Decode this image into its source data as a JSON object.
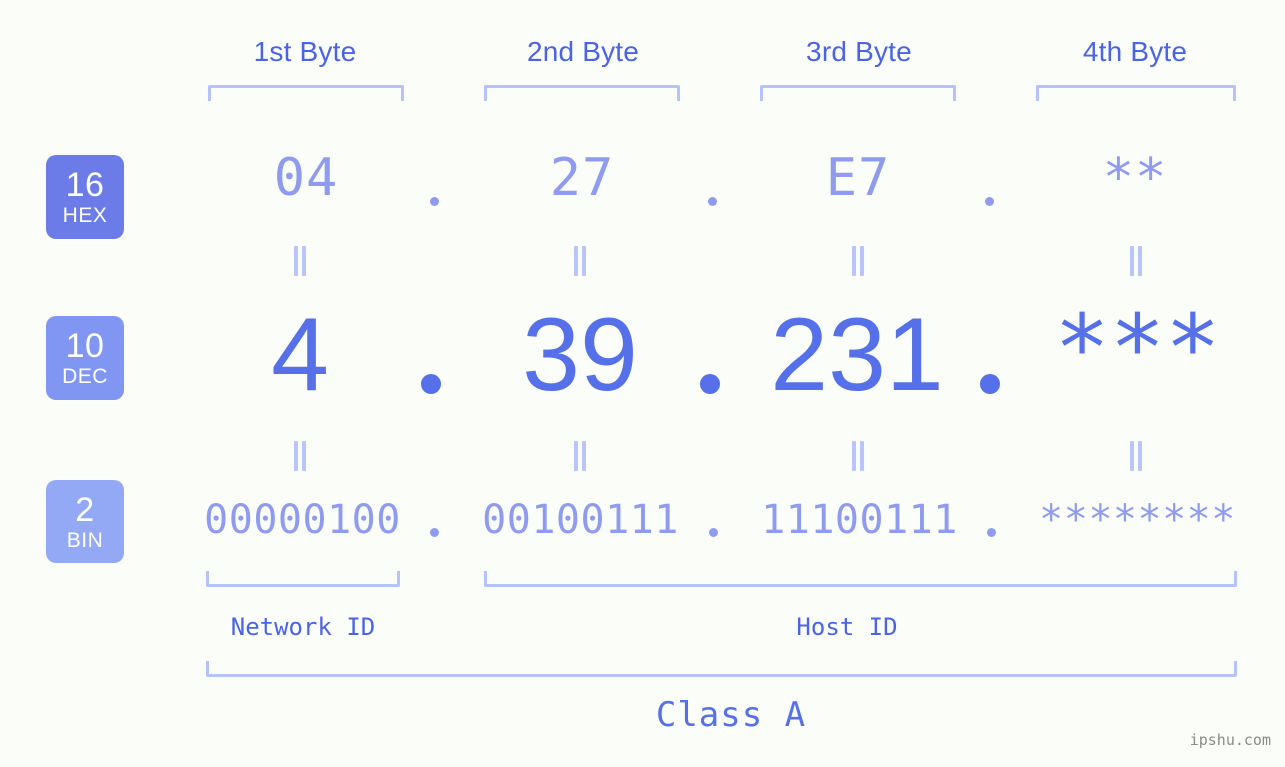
{
  "watermark": "ipshu.com",
  "byte_headers": [
    {
      "label": "1st Byte"
    },
    {
      "label": "2nd Byte"
    },
    {
      "label": "3rd Byte"
    },
    {
      "label": "4th Byte"
    }
  ],
  "rows": [
    {
      "base": "16",
      "base_name": "HEX",
      "badge_color": "#6b7ce9",
      "text_color": "#8e9bf0",
      "values": [
        "04",
        "27",
        "E7",
        "**"
      ],
      "separator": "."
    },
    {
      "base": "10",
      "base_name": "DEC",
      "badge_color": "#8196f2",
      "text_color": "#5570e8",
      "values": [
        "4",
        "39",
        "231",
        "***"
      ],
      "separator": "."
    },
    {
      "base": "2",
      "base_name": "BIN",
      "badge_color": "#93a9f6",
      "text_color": "#8e9bf0",
      "values": [
        "00000100",
        "00100111",
        "11100111",
        "********"
      ],
      "separator": "."
    }
  ],
  "equality_symbol": "=",
  "segments": {
    "network_id": "Network ID",
    "host_id": "Host ID"
  },
  "class_label": "Class A",
  "colors": {
    "background": "#fbfdf9",
    "bracket": "#b6c2fb",
    "header_text": "#4a63e7",
    "dec_text": "#5570e8",
    "hex_bin_text": "#8e9bf0",
    "watermark_text": "#8a8a8a"
  }
}
